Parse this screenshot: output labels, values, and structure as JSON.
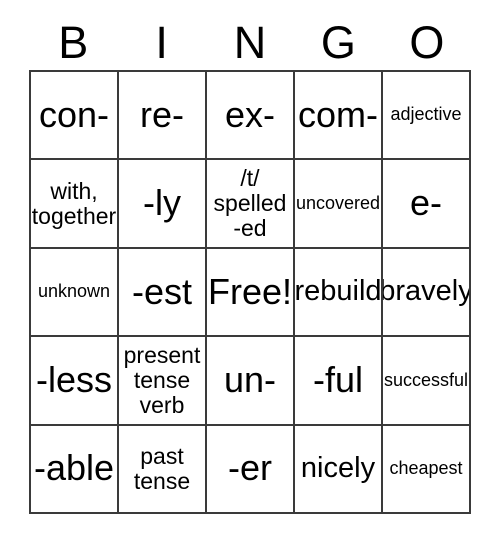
{
  "card": {
    "title": "BINGO",
    "headers": [
      "B",
      "I",
      "N",
      "G",
      "O"
    ],
    "border_color": "#3a3a3a",
    "background_color": "#ffffff",
    "text_color": "#000000",
    "rows": 5,
    "columns": 5,
    "free_space": {
      "row": 3,
      "column": 3,
      "label": "Free!"
    },
    "cells": [
      {
        "text": "con-",
        "size": "xl"
      },
      {
        "text": "re-",
        "size": "xl"
      },
      {
        "text": "ex-",
        "size": "xl"
      },
      {
        "text": "com-",
        "size": "xl"
      },
      {
        "text": "adjective",
        "size": "xs"
      },
      {
        "text": "with,\ntogether",
        "size": "sm"
      },
      {
        "text": "-ly",
        "size": "xl"
      },
      {
        "text": "/t/\nspelled\n-ed",
        "size": "sm"
      },
      {
        "text": "uncovered",
        "size": "xs"
      },
      {
        "text": "e-",
        "size": "xl"
      },
      {
        "text": "unknown",
        "size": "xs"
      },
      {
        "text": "-est",
        "size": "xl"
      },
      {
        "text": "Free!",
        "size": "xl"
      },
      {
        "text": "rebuild",
        "size": "md"
      },
      {
        "text": "bravely",
        "size": "md"
      },
      {
        "text": "-less",
        "size": "xl"
      },
      {
        "text": "present\ntense\nverb",
        "size": "sm"
      },
      {
        "text": "un-",
        "size": "xl"
      },
      {
        "text": "-ful",
        "size": "xl"
      },
      {
        "text": "successful",
        "size": "xs"
      },
      {
        "text": "-able",
        "size": "xl"
      },
      {
        "text": "past\ntense",
        "size": "sm"
      },
      {
        "text": "-er",
        "size": "xl"
      },
      {
        "text": "nicely",
        "size": "md"
      },
      {
        "text": "cheapest",
        "size": "xs"
      }
    ]
  }
}
